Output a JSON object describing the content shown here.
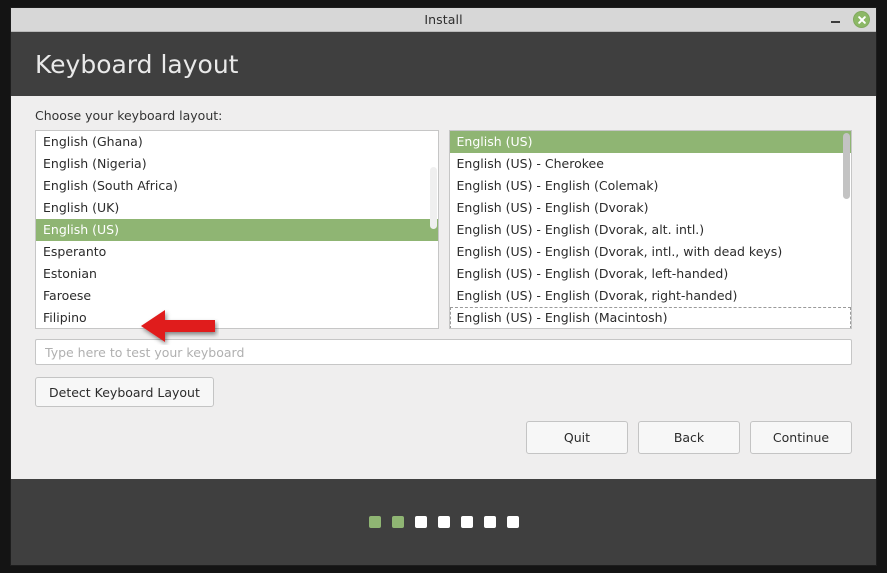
{
  "window": {
    "title": "Install",
    "controls": {
      "minimize_label": "minimize",
      "close_label": "close"
    }
  },
  "header": {
    "title": "Keyboard layout"
  },
  "main": {
    "prompt": "Choose your keyboard layout:",
    "layout_list": {
      "selected": "English (US)",
      "items": [
        "English (Ghana)",
        "English (Nigeria)",
        "English (South Africa)",
        "English (UK)",
        "English (US)",
        "Esperanto",
        "Estonian",
        "Faroese",
        "Filipino"
      ]
    },
    "variant_list": {
      "selected": "English (US)",
      "items": [
        "English (US)",
        "English (US) - Cherokee",
        "English (US) - English (Colemak)",
        "English (US) - English (Dvorak)",
        "English (US) - English (Dvorak, alt. intl.)",
        "English (US) - English (Dvorak, intl., with dead keys)",
        "English (US) - English (Dvorak, left-handed)",
        "English (US) - English (Dvorak, right-handed)",
        "English (US) - English (Macintosh)"
      ]
    },
    "test_input": {
      "value": "",
      "placeholder": "Type here to test your keyboard"
    },
    "detect_button": "Detect Keyboard Layout"
  },
  "nav": {
    "quit": "Quit",
    "back": "Back",
    "continue": "Continue"
  },
  "footer": {
    "step_count": 7,
    "current_step": 2,
    "dots": [
      true,
      true,
      false,
      false,
      false,
      false,
      false
    ]
  },
  "annotation": {
    "arrow": "red-left-arrow pointing at selected keyboard layout"
  },
  "colors": {
    "accent_green": "#8fb573",
    "header_dark": "#3f3f3f",
    "content_bg": "#efeeee",
    "titlebar_bg": "#d7d7d7",
    "annotation_red": "#e01b1b"
  }
}
